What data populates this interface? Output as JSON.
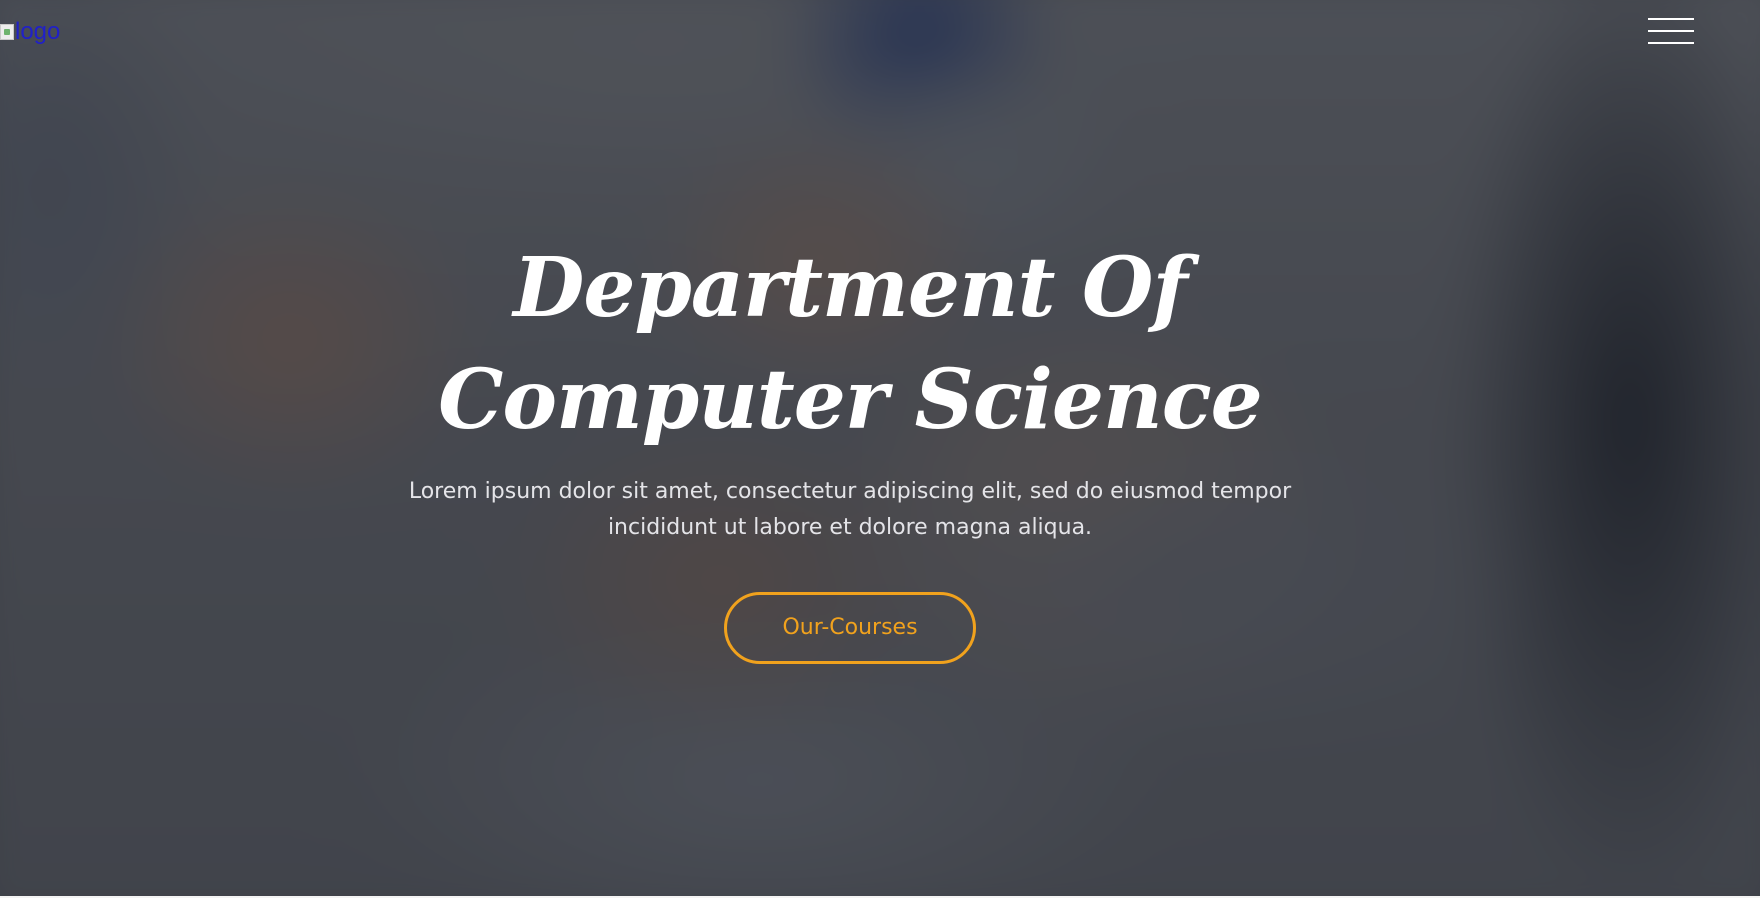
{
  "header": {
    "logo_alt": "logo",
    "menu_icon": "hamburger-menu-icon"
  },
  "hero": {
    "title": "Department Of Computer Science",
    "subtitle": "Lorem ipsum dolor sit amet, consectetur adipiscing elit, sed do eiusmod tempor incididunt ut labore et dolore magna aliqua.",
    "cta_label": "Our-Courses"
  },
  "colors": {
    "accent": "#f1a21d",
    "title_text": "#ffffff",
    "overlay": "#1c1e26",
    "logo_alt_link": "#2020c8"
  }
}
